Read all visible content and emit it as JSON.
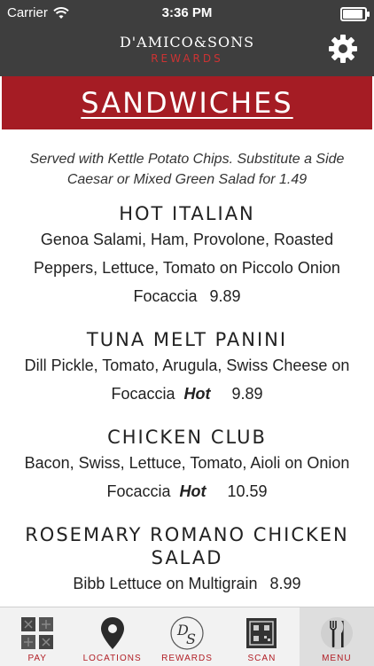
{
  "status": {
    "carrier": "Carrier",
    "time": "3:36 PM"
  },
  "header": {
    "brand": "D'AMICO&SONS",
    "subtitle": "REWARDS"
  },
  "section": {
    "title": "SANDWICHES"
  },
  "intro": "Served with Kettle Potato Chips. Substitute a Side Caesar or Mixed Green Salad for 1.49",
  "items": [
    {
      "title": "HOT ITALIAN",
      "desc": "Genoa Salami, Ham, Provolone, Roasted Peppers, Lettuce, Tomato on Piccolo Onion Focaccia",
      "hot": "",
      "price": "9.89"
    },
    {
      "title": "TUNA MELT PANINI",
      "desc": "Dill Pickle, Tomato, Arugula, Swiss Cheese on Focaccia",
      "hot": "Hot",
      "price": "9.89"
    },
    {
      "title": "CHICKEN CLUB",
      "desc": "Bacon, Swiss, Lettuce, Tomato, Aioli on Onion Focaccia",
      "hot": "Hot",
      "price": "10.59"
    },
    {
      "title": "ROSEMARY ROMANO CHICKEN SALAD",
      "desc": "Bibb Lettuce on Multigrain",
      "hot": "",
      "price": "8.99"
    }
  ],
  "tabs": [
    {
      "label": "PAY",
      "icon": "pay-grid-icon"
    },
    {
      "label": "LOCATIONS",
      "icon": "map-pin-icon"
    },
    {
      "label": "REWARDS",
      "icon": "ds-monogram-icon"
    },
    {
      "label": "SCAN",
      "icon": "qr-code-icon"
    },
    {
      "label": "MENU",
      "icon": "fork-knife-icon"
    }
  ],
  "active_tab": "MENU",
  "colors": {
    "topbar": "#3e3e3e",
    "accent": "#a51c24",
    "tab_label": "#b11e25"
  }
}
